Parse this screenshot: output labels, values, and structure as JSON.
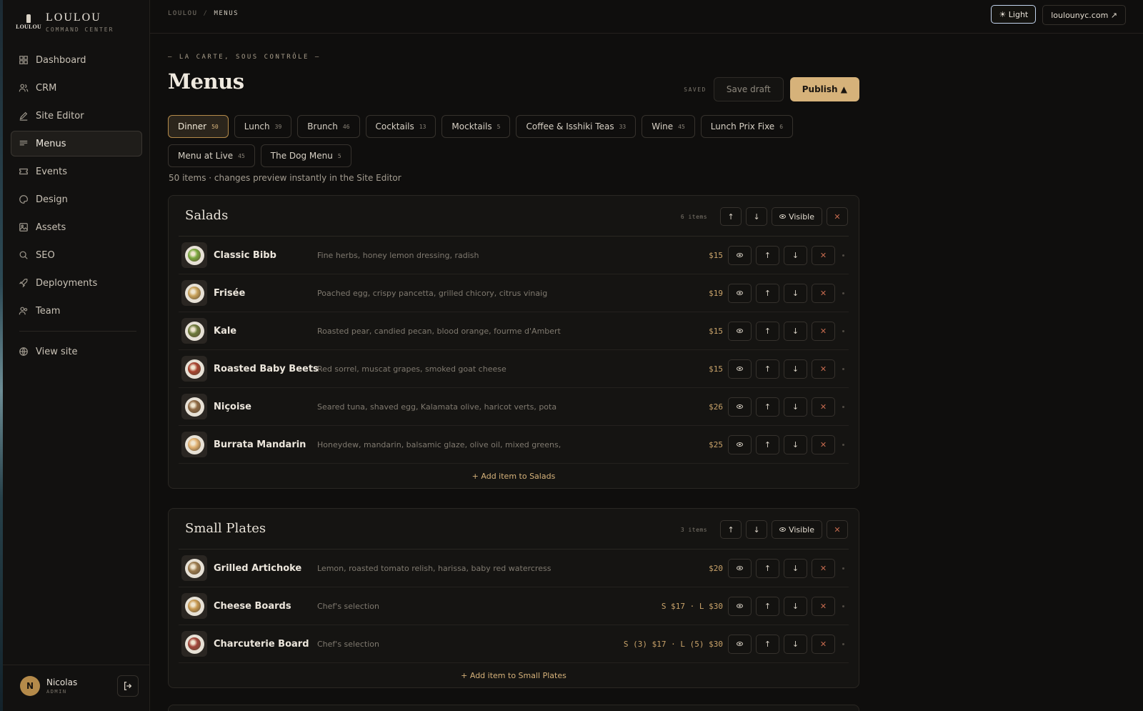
{
  "brand": {
    "name": "LOULOU",
    "subtitle": "COMMAND CENTER",
    "logo_text": "LOULOU"
  },
  "nav": [
    {
      "label": "Dashboard",
      "icon": "grid-icon",
      "active": false
    },
    {
      "label": "CRM",
      "icon": "users-icon",
      "active": false
    },
    {
      "label": "Site Editor",
      "icon": "pencil-icon",
      "active": false
    },
    {
      "label": "Menus",
      "icon": "menu-lines-icon",
      "active": true
    },
    {
      "label": "Events",
      "icon": "ticket-icon",
      "active": false
    },
    {
      "label": "Design",
      "icon": "palette-icon",
      "active": false
    },
    {
      "label": "Assets",
      "icon": "image-icon",
      "active": false
    },
    {
      "label": "SEO",
      "icon": "search-icon",
      "active": false
    },
    {
      "label": "Deployments",
      "icon": "rocket-icon",
      "active": false
    },
    {
      "label": "Team",
      "icon": "team-icon",
      "active": false
    }
  ],
  "nav_secondary": {
    "label": "View site",
    "icon": "globe-icon"
  },
  "user": {
    "initial": "N",
    "name": "Nicolas",
    "role": "ADMIN"
  },
  "breadcrumb": {
    "root": "LOULOU",
    "sep": "/",
    "current": "MENUS"
  },
  "topbar": {
    "theme_label": "☀ Light",
    "site_label": "loulounyc.com ↗"
  },
  "page": {
    "eyebrow": "— LA CARTE, SOUS CONTRÔLE —",
    "title": "Menus",
    "status": "SAVED",
    "save_draft": "Save draft",
    "publish": "Publish ▲",
    "summary": "50 items · changes preview instantly in the Site Editor"
  },
  "tabs": [
    {
      "label": "Dinner",
      "count": "50",
      "active": true
    },
    {
      "label": "Lunch",
      "count": "39"
    },
    {
      "label": "Brunch",
      "count": "46"
    },
    {
      "label": "Cocktails",
      "count": "13"
    },
    {
      "label": "Mocktails",
      "count": "5"
    },
    {
      "label": "Coffee & Isshiki Teas",
      "count": "33"
    },
    {
      "label": "Wine",
      "count": "45"
    },
    {
      "label": "Lunch Prix Fixe",
      "count": "6"
    },
    {
      "label": "Menu at Live",
      "count": "45"
    },
    {
      "label": "The Dog Menu",
      "count": "5"
    }
  ],
  "controls": {
    "up": "↑",
    "down": "↓",
    "remove": "✕",
    "visible": "Visible"
  },
  "sections": [
    {
      "title": "Salads",
      "count_label": "6 items",
      "add_label": "+ Add item to Salads",
      "items": [
        {
          "name": "Classic Bibb",
          "desc": "Fine herbs, honey lemon dressing, radish",
          "price": "$15",
          "food_color": "#7aa83e"
        },
        {
          "name": "Frisée",
          "desc": "Poached egg, crispy pancetta, grilled chicory, citrus vinaig",
          "price": "$19",
          "food_color": "#c9a25a"
        },
        {
          "name": "Kale",
          "desc": "Roasted pear, candied pecan, blood orange, fourme d'Ambert",
          "price": "$15",
          "food_color": "#6d7a3a"
        },
        {
          "name": "Roasted Baby Beets",
          "desc": "Red sorrel, muscat grapes, smoked goat cheese",
          "price": "$15",
          "food_color": "#a8432f"
        },
        {
          "name": "Niçoise",
          "desc": "Seared tuna, shaved egg, Kalamata olive, haricot verts, pota",
          "price": "$26",
          "food_color": "#8f6a45"
        },
        {
          "name": "Burrata Mandarin",
          "desc": "Honeydew, mandarin, balsamic glaze, olive oil, mixed greens,",
          "price": "$25",
          "food_color": "#e0b070"
        }
      ]
    },
    {
      "title": "Small Plates",
      "count_label": "3 items",
      "add_label": "+ Add item to Small Plates",
      "items": [
        {
          "name": "Grilled Artichoke",
          "desc": "Lemon, roasted tomato relish, harissa, baby red watercress",
          "price": "$20",
          "food_color": "#9a7a4e"
        },
        {
          "name": "Cheese Boards",
          "desc": "Chef's selection",
          "price": "S $17 · L $30",
          "food_color": "#c89a52"
        },
        {
          "name": "Charcuterie Board",
          "desc": "Chef's selection",
          "price": "S (3) $17 · L (5) $30",
          "food_color": "#a2463a"
        }
      ]
    }
  ]
}
